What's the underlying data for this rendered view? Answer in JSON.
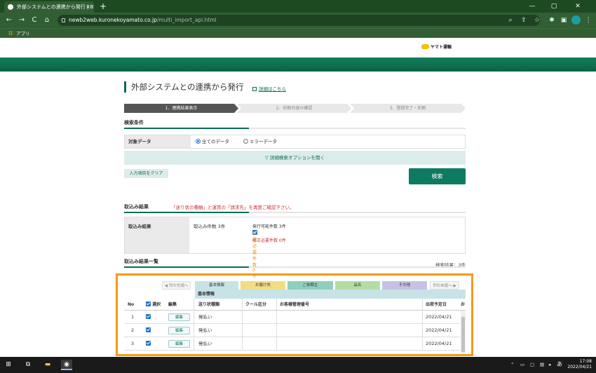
{
  "browser": {
    "tab_title": "外部システムとの連携から発行 | B2",
    "tab_close": "×",
    "new_tab": "+",
    "win_min": "—",
    "win_max": "▢",
    "win_close": "✕",
    "nav_back": "←",
    "nav_forward": "→",
    "nav_reload": "C",
    "nav_home": "⌂",
    "url_host": "newb2web.kuronekoyamato.co.jp",
    "url_path": "/multi_import_api.html",
    "bookmark": "アプリ"
  },
  "site": {
    "logo": "ヤマト運輸"
  },
  "page": {
    "title": "外部システムとの連携から発行",
    "detail_link": "詳細はこちら",
    "steps": [
      "1．連携結果表示",
      "2．印刷内容の確認",
      "3．登録完了・印刷"
    ]
  },
  "search": {
    "section_title": "検索条件",
    "target_label": "対象データ",
    "option_all": "全てのデータ",
    "option_error": "エラーデータ",
    "advanced": "▽ 詳細検索オプションを開く",
    "clear_button": "入力項目をクリア",
    "search_button": "検索"
  },
  "import_result": {
    "section_title": "取込み結果",
    "warning": "「送り状の種類」と運賃の「請求先」を再度ご確認下さい。",
    "label": "取込み結果",
    "count": "取込み件数 3件",
    "issuable": "発行可能件数 3件",
    "need_check": "確認必要件数 0件",
    "need_fix": "修正必要件数 0件"
  },
  "list": {
    "section_title": "取込み結果一覧",
    "count": "検索結果：3件",
    "scroll_left": "◀ 列の先頭へ",
    "scroll_right": "列の末尾へ ▶",
    "tabs": [
      {
        "label": "基本情報",
        "color": "#c7e3e8"
      },
      {
        "label": "お届け先",
        "color": "#f2dc86"
      },
      {
        "label": "ご依頼主",
        "color": "#8fcfbf"
      },
      {
        "label": "品名",
        "color": "#b6dca6"
      },
      {
        "label": "その他",
        "color": "#c9c1e3"
      }
    ],
    "group_header": "基本情報",
    "headers": {
      "no": "No",
      "select": "選択",
      "edit": "編集",
      "slip_type": "送り状種類",
      "cool": "クール区分",
      "customer_no": "お客様管理番号",
      "ship_date": "出荷予定日",
      "more": "お"
    },
    "rows": [
      {
        "no": "1",
        "edit": "編集",
        "slip_type": "発払い",
        "ship_date": "2022/04/21"
      },
      {
        "no": "2",
        "edit": "編集",
        "slip_type": "発払い",
        "ship_date": "2022/04/21"
      },
      {
        "no": "3",
        "edit": "編集",
        "slip_type": "発払い",
        "ship_date": "2022/04/21"
      }
    ]
  },
  "taskbar": {
    "time": "17:08",
    "date": "2022/04/21",
    "ime": "あ"
  }
}
